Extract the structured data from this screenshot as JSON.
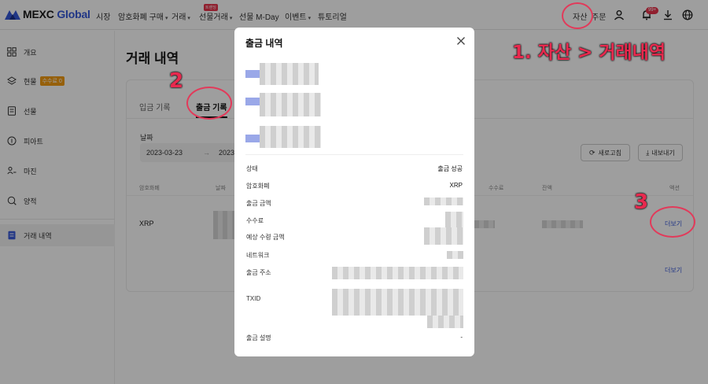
{
  "nav": {
    "logo": "MEXC Global",
    "logo_main": "MEXC",
    "logo_accent": "Global",
    "items": [
      "시장",
      "암호화폐 구매",
      "거래",
      "선물거래",
      "선물 M-Day",
      "이벤트",
      "튜토리얼"
    ],
    "futures_badge": "트렌딩",
    "assets": "자산",
    "orders": "주문",
    "notif_count": "99+"
  },
  "sidebar": {
    "items": [
      "개요",
      "현물",
      "선물",
      "피아트",
      "마진",
      "양적",
      "거래 내역"
    ],
    "fee_badge": "수수료 0"
  },
  "main": {
    "title": "거래 내역",
    "tabs": [
      "입금 기록",
      "출금 기록"
    ],
    "date_label": "날짜",
    "date_from": "2023-03-23",
    "date_arrow": "→",
    "date_to": "2023",
    "refresh": "새로고침",
    "export": "내보내기",
    "columns": [
      "암호화폐",
      "날짜",
      "수수료",
      "잔액",
      "액션"
    ],
    "row_coin": "XRP",
    "more": "더보기"
  },
  "modal": {
    "title": "출금 내역",
    "fields": [
      {
        "label": "상태",
        "value": "출금 성공"
      },
      {
        "label": "암호화폐",
        "value": "XRP"
      },
      {
        "label": "출금 금액",
        "value": ""
      },
      {
        "label": "수수료",
        "value": ""
      },
      {
        "label": "예상 수령 금액",
        "value": ""
      },
      {
        "label": "네트워크",
        "value": ""
      },
      {
        "label": "출금 주소",
        "value": ""
      },
      {
        "label": "TXID",
        "value": ""
      },
      {
        "label": "출금 설명",
        "value": "-"
      }
    ]
  },
  "annotations": {
    "step1": "1. 자산 > 거래내역",
    "step2": "2",
    "step3": "3"
  },
  "colors": {
    "accent": "#3a5bd9",
    "annotation": "#e8294e",
    "badge": "#f39c12"
  }
}
